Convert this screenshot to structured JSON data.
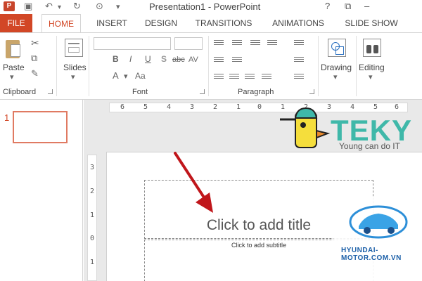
{
  "window": {
    "title": "Presentation1 - PowerPoint",
    "app_icon": "powerpoint-icon",
    "controls": [
      "?",
      "⧉",
      "–"
    ]
  },
  "tabs": [
    {
      "label": "FILE"
    },
    {
      "label": "HOME"
    },
    {
      "label": "INSERT"
    },
    {
      "label": "DESIGN"
    },
    {
      "label": "TRANSITIONS"
    },
    {
      "label": "ANIMATIONS"
    },
    {
      "label": "SLIDE SHOW"
    }
  ],
  "ribbon": {
    "paste_label": "Paste",
    "slides_label": "Slides",
    "drawing_label": "Drawing",
    "editing_label": "Editing",
    "groups": {
      "clipboard": "Clipboard",
      "font": "Font",
      "paragraph": "Paragraph"
    },
    "font_buttons": {
      "bold": "B",
      "italic": "I",
      "underline": "U",
      "shadow": "S",
      "strike": "abc",
      "spacing": "AV",
      "font_color": "A",
      "case": "Aa"
    }
  },
  "slides_panel": {
    "slide_number": "1"
  },
  "ruler": {
    "horizontal": [
      "6",
      "5",
      "4",
      "3",
      "2",
      "1",
      "0",
      "1",
      "2",
      "3",
      "4",
      "5",
      "6"
    ],
    "vertical": [
      "3",
      "2",
      "1",
      "0",
      "1"
    ]
  },
  "slide": {
    "title_placeholder": "Click to add title",
    "subtitle_placeholder": "Click to add subtitle"
  },
  "overlay": {
    "logo_text": "TEKY",
    "logo_tagline": "Young can do IT",
    "watermark_text": "HYUNDAI-MOTOR.COM.VN"
  },
  "colors": {
    "accent": "#d24726",
    "teky": "#3fb8a9",
    "arrow": "#c0161b"
  }
}
